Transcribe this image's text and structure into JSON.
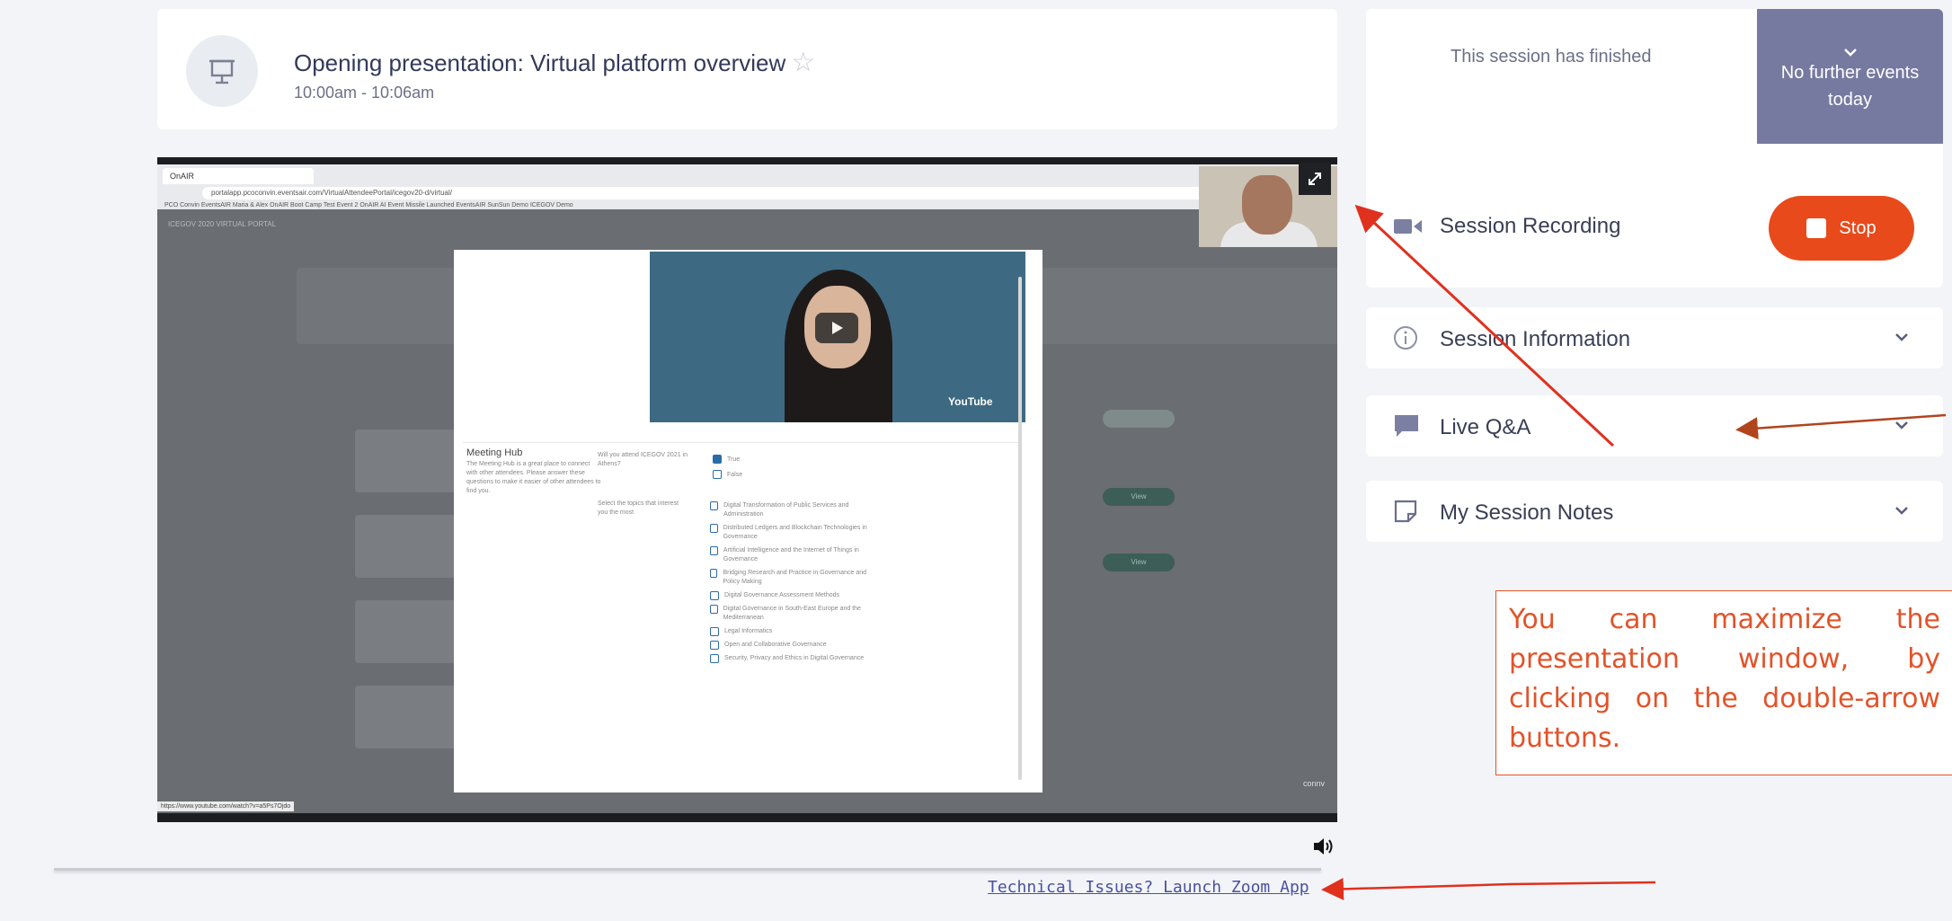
{
  "session": {
    "title": "Opening presentation: Virtual platform overview",
    "time": "10:00am - 10:06am",
    "status": "This session has finished",
    "next_events": "No further events today"
  },
  "video": {
    "browser_tab": "OnAIR",
    "url": "portalapp.pcoconvin.eventsair.com/VirtualAttendeePortal/icegov20-d/virtual/",
    "bookmarks": "PCO Convin   EventsAIR   Maria & Alex   OnAIR Boot Camp   Test Event 2   OnAIR AI Event   Missile Launched   EventsAIR   SunSun Demo   ICEGOV Demo",
    "portal_label": "ICEGOV 2020 VIRTUAL PORTAL",
    "youtube_label": "YouTube",
    "meeting_hub_title": "Meeting Hub",
    "meeting_hub_text": "The Meeting Hub is a great place to connect with other attendees. Please answer these questions to make it easier of other attendees to find you.",
    "question_1": "Will you attend ICEGOV 2021 in Athens?",
    "question_2": "Select the topics that interest you the most",
    "answers_q1": [
      "True",
      "False"
    ],
    "topics": [
      "Digital Transformation of Public Services and Administration",
      "Distributed Ledgers and Blockchain Technologies in Governance",
      "Artificial Intelligence and the Internet of Things in Governance",
      "Bridging Research and Practice in Governance and Policy Making",
      "Digital Governance Assessment Methods",
      "Digital Governance in South-East Europe and the Mediterranean",
      "Legal Informatics",
      "Open and Collaborative Governance",
      "Security, Privacy and Ethics in Digital Governance"
    ],
    "view_label": "View",
    "status_url": "https://www.youtube.com/watch?v=a5Ps7Ojdo",
    "brand_mark": "connv"
  },
  "footer": {
    "zoom_link": "Technical Issues? Launch Zoom App"
  },
  "panels": {
    "recording_label": "Session Recording",
    "stop_label": "Stop",
    "info_label": "Session Information",
    "qa_label": "Live Q&A",
    "notes_label": "My Session Notes"
  },
  "annotation": {
    "text": "You can maximize the presentation window, by clicking on the double-arrow buttons."
  },
  "colors": {
    "accent_orange": "#e84a1b",
    "status_purple": "#767aa0",
    "annotation_red": "#e2532a",
    "arrow_red": "#e0301e",
    "arrow_brown": "#b2441c"
  }
}
